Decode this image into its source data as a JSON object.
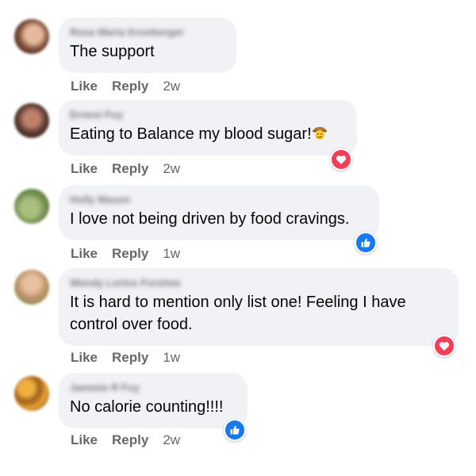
{
  "comments": [
    {
      "author": "Rosa Maria Kronberger",
      "text": "The support",
      "actions": {
        "like": "Like",
        "reply": "Reply",
        "time": "2w"
      },
      "avatar_colors": [
        "#c98b6b",
        "#5a3a2a"
      ]
    },
    {
      "author": "Ernest Foy",
      "text": "Eating to Balance my blood sugar!",
      "emoji": "cowboy-face-emoji",
      "reaction": "love-icon",
      "actions": {
        "like": "Like",
        "reply": "Reply",
        "time": "2w"
      },
      "avatar_colors": [
        "#a56e5a",
        "#3b2a25"
      ]
    },
    {
      "author": "Holly Mason",
      "text": "I love not being driven by food cravings.",
      "reaction": "like-icon",
      "actions": {
        "like": "Like",
        "reply": "Reply",
        "time": "1w"
      },
      "avatar_colors": [
        "#8fa86a",
        "#4d6b3a"
      ]
    },
    {
      "author": "Wendy Lorins Forshee",
      "text_lines": [
        "It is hard to mention only list one! Feeling I have",
        "control over food."
      ],
      "reaction": "love-icon",
      "actions": {
        "like": "Like",
        "reply": "Reply",
        "time": "1w"
      },
      "avatar_colors": [
        "#c9a37a",
        "#7a9a55"
      ]
    },
    {
      "author": "Jammie R Foy",
      "text": "No calorie counting!!!!",
      "reaction": "like-icon",
      "actions": {
        "like": "Like",
        "reply": "Reply",
        "time": "2w"
      },
      "avatar_colors": [
        "#e0a030",
        "#a05a20"
      ]
    }
  ],
  "colors": {
    "bubble": "#f0f2f5",
    "love": "#f33e58",
    "like": "#1877f2",
    "secondary_text": "#65676b"
  }
}
